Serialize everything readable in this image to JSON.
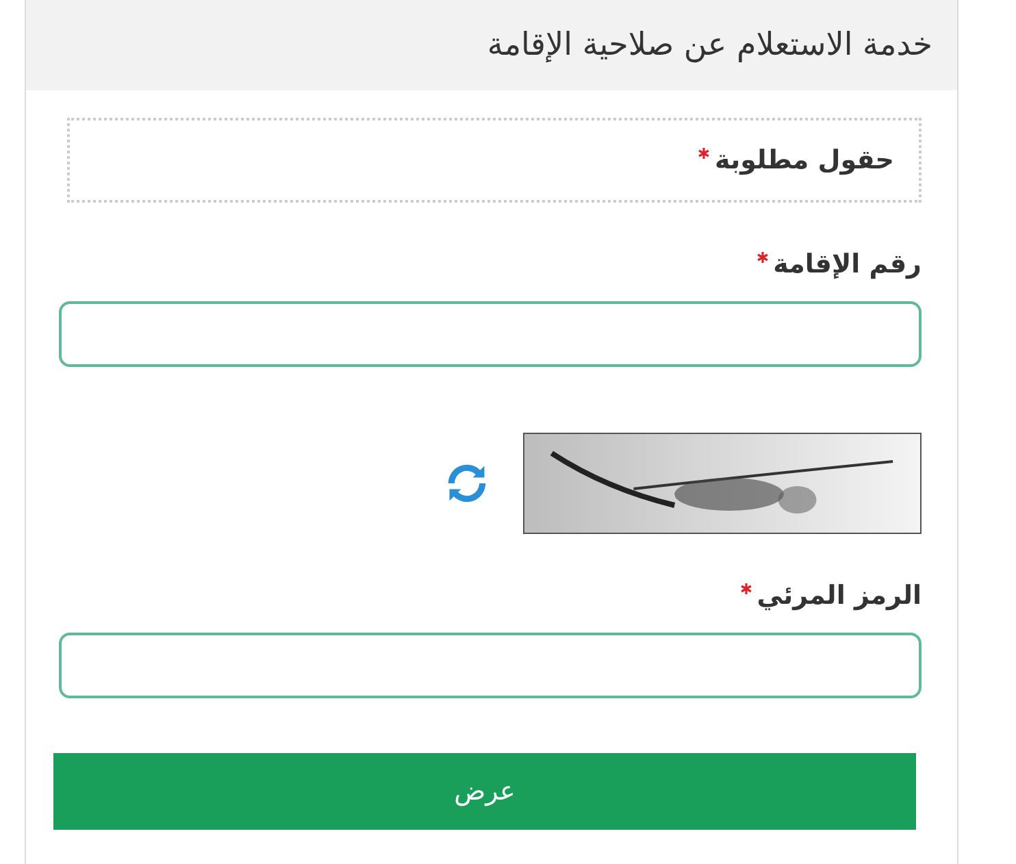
{
  "panel": {
    "title": "خدمة الاستعلام عن صلاحية الإقامة"
  },
  "notice": {
    "text": "حقول مطلوبة",
    "required": true
  },
  "fields": [
    {
      "kind": "text",
      "label": "رقم الإقامة",
      "required": true
    },
    {
      "kind": "captcha",
      "label": "الرمز المرئي",
      "required": true
    }
  ],
  "submit": {
    "label": "عرض"
  }
}
